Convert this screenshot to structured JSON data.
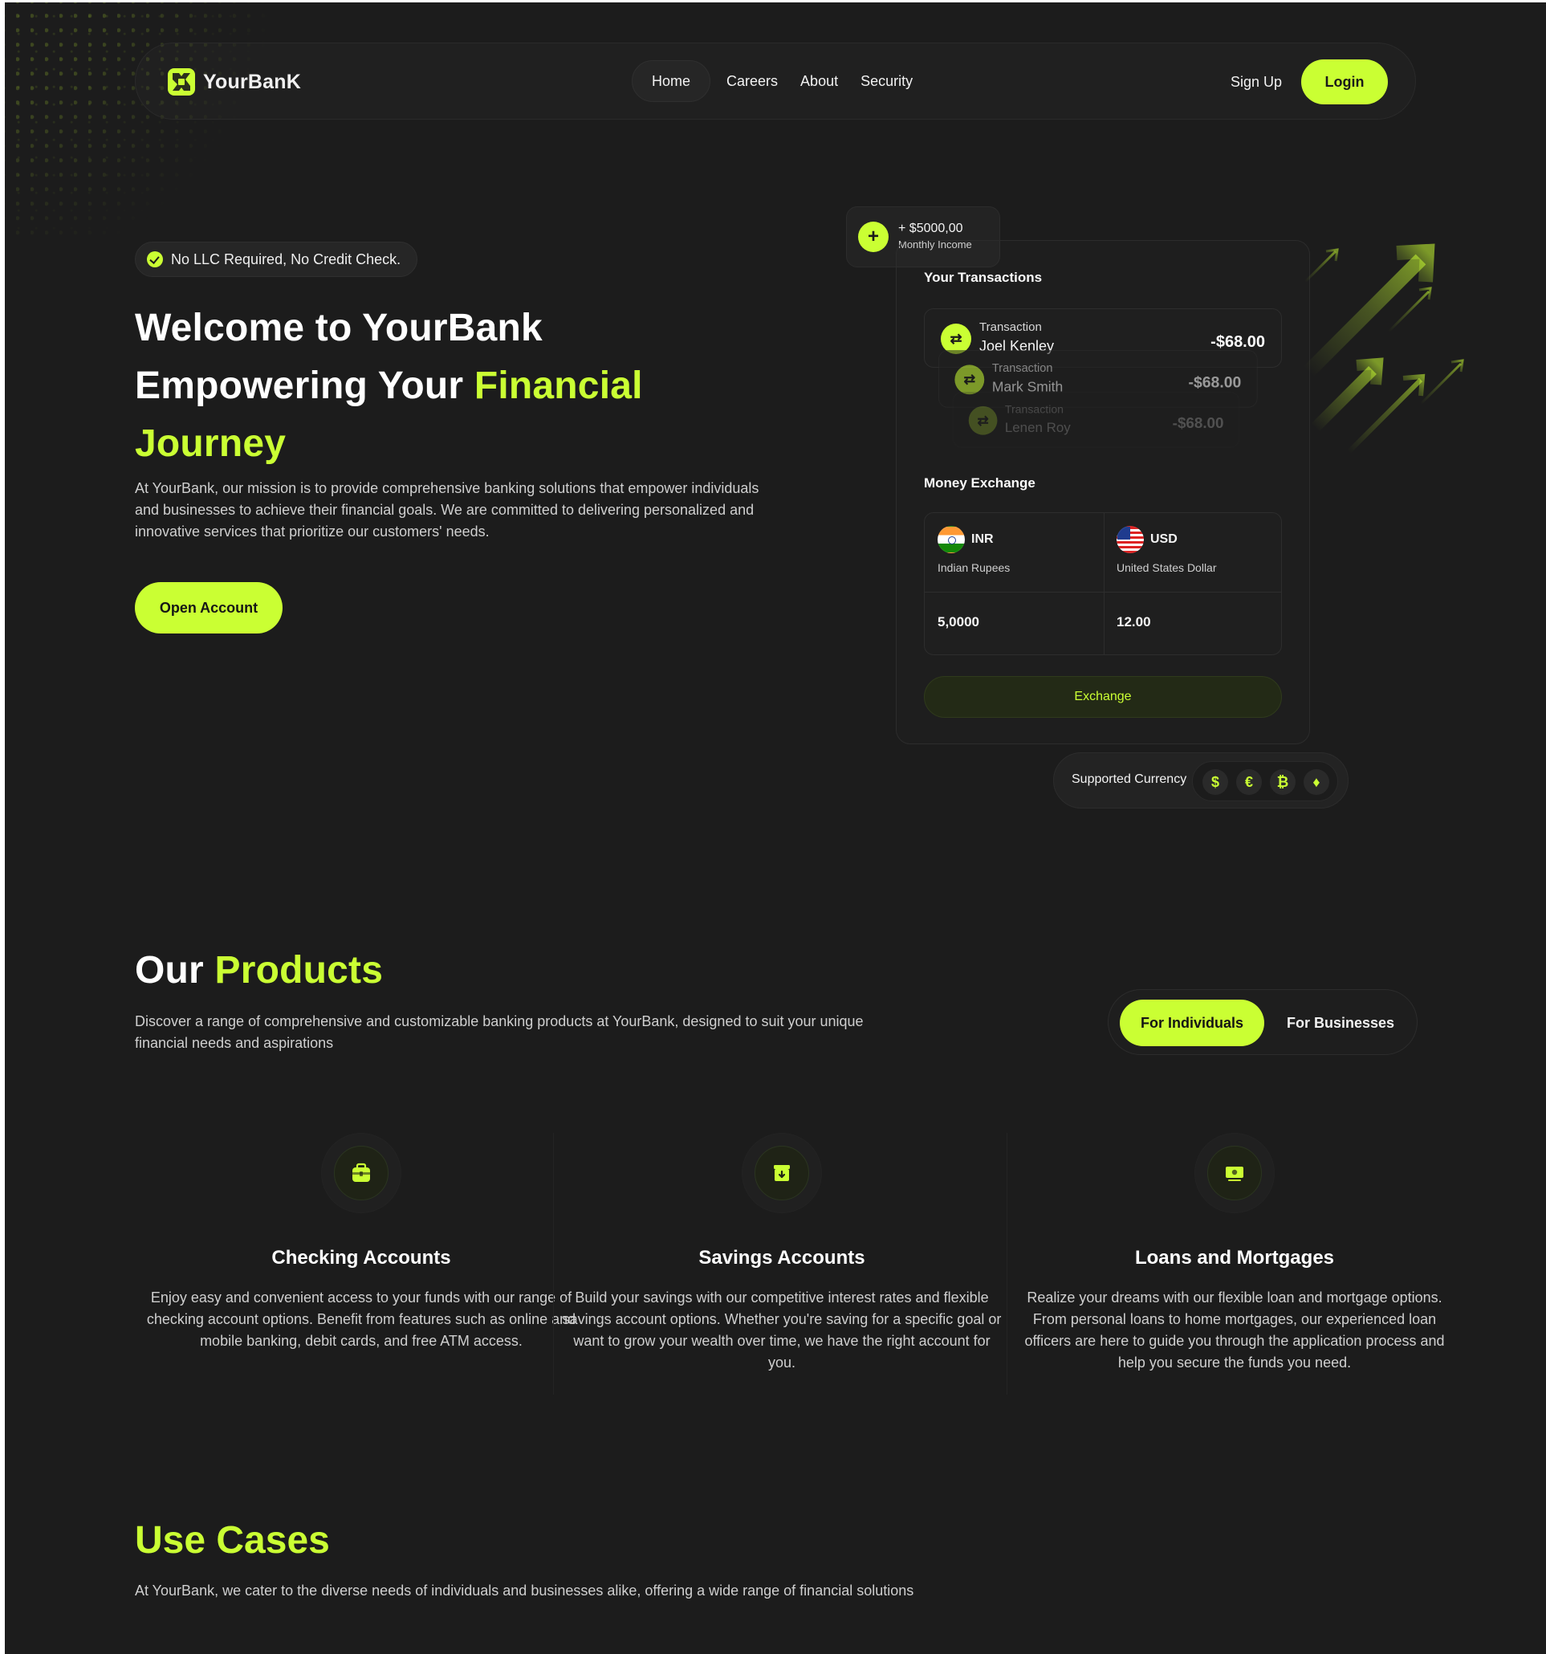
{
  "colors": {
    "accent": "#caff33",
    "background": "#1c1c1c"
  },
  "nav": {
    "brand": "YourBanK",
    "links": [
      "Home",
      "Careers",
      "About",
      "Security"
    ],
    "active": "Home",
    "signup": "Sign Up",
    "login": "Login"
  },
  "hero": {
    "badge": "No LLC Required, No Credit Check.",
    "title_line1": "Welcome to YourBank",
    "title_line2_prefix": "Empowering Your ",
    "title_line2_highlight": "Financial",
    "title_line3_highlight": "Journey",
    "description": "At YourBank, our mission is to provide comprehensive banking solutions that empower individuals and businesses to achieve their financial goals. We are committed to delivering personalized and innovative services that prioritize our customers' needs.",
    "cta": "Open Account"
  },
  "widget": {
    "income": {
      "amount": "+ $5000,00",
      "label": "Monthly Income"
    },
    "transactions_title": "Your Transactions",
    "transactions": [
      {
        "label": "Transaction",
        "name": "Joel Kenley",
        "amount": "-$68.00"
      },
      {
        "label": "Transaction",
        "name": "Mark Smith",
        "amount": "-$68.00"
      },
      {
        "label": "Transaction",
        "name": "Lenen Roy",
        "amount": "-$68.00"
      }
    ],
    "exchange_title": "Money Exchange",
    "from": {
      "code": "INR",
      "name": "Indian Rupees",
      "value": "5,0000"
    },
    "to": {
      "code": "USD",
      "name": "United States Dollar",
      "value": "12.00"
    },
    "exchange_button": "Exchange",
    "supported_label": "Supported Currency",
    "supported_icons": [
      "dollar-icon",
      "euro-icon",
      "bitcoin-icon",
      "ethereum-icon"
    ],
    "supported_symbols": [
      "$",
      "€",
      "₿",
      "♦"
    ]
  },
  "products": {
    "title_prefix": "Our ",
    "title_highlight": "Products",
    "description": "Discover a range of comprehensive and customizable banking products at YourBank, designed to suit your unique financial needs and aspirations",
    "tabs": [
      "For Individuals",
      "For Businesses"
    ],
    "active_tab": "For Individuals",
    "items": [
      {
        "icon": "briefcase-icon",
        "title": "Checking Accounts",
        "description": "Enjoy easy and convenient access to your funds with our range of checking account options. Benefit from features such as online and mobile banking, debit cards, and free ATM access."
      },
      {
        "icon": "savings-box-icon",
        "title": "Savings Accounts",
        "description": "Build your savings with our competitive interest rates and flexible savings account options. Whether you're saving for a specific goal or want to grow your wealth over time, we have the right account for you."
      },
      {
        "icon": "cash-icon",
        "title": "Loans and Mortgages",
        "description": "Realize your dreams with our flexible loan and mortgage options. From personal loans to home mortgages, our experienced loan officers are here to guide you through the application process and help you secure the funds you need."
      }
    ]
  },
  "use_cases": {
    "title": "Use Cases",
    "description": "At YourBank, we cater to the diverse needs of individuals and businesses alike, offering a wide range of financial solutions"
  }
}
